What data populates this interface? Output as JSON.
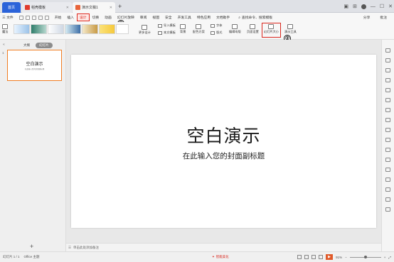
{
  "tabs": {
    "home": "首页",
    "doc1": "稻壳模板",
    "doc2": "演示文稿1"
  },
  "menu": {
    "file": "三 文件",
    "items": [
      "开始",
      "插入",
      "设计",
      "切换",
      "动画",
      "幻灯片放映",
      "审阅",
      "视图",
      "安全",
      "开发工具",
      "特色应用",
      "文档助手"
    ],
    "search": "查找命令、搜索模板",
    "share": "分享",
    "comment": "批注"
  },
  "ribbon": {
    "beautify": "魔法",
    "more_design": "更多设计",
    "import_template": "导入模板",
    "this_template": "本文模板",
    "background": "背景",
    "edit_master": "配色方案",
    "font": "字体",
    "layout": "版式",
    "edit_color": "编辑母版",
    "page_setup": "页面设置",
    "slide_size": "幻灯片大小",
    "show_tools": "演示工具"
  },
  "markers": {
    "one": "①",
    "two": "②"
  },
  "panel": {
    "outline": "大纲",
    "slides": "幻灯片",
    "thumb_num": "1",
    "thumb_title": "空白演示",
    "thumb_sub": "在此输入您的封面副标题"
  },
  "slide": {
    "title": "空白演示",
    "subtitle": "在此输入您的封面副标题"
  },
  "notes": "单击此处添加备注",
  "status": {
    "slide": "幻灯片 1 / 1",
    "theme": "Office 主题",
    "beautify": "智能美化",
    "zoom": "91%"
  }
}
